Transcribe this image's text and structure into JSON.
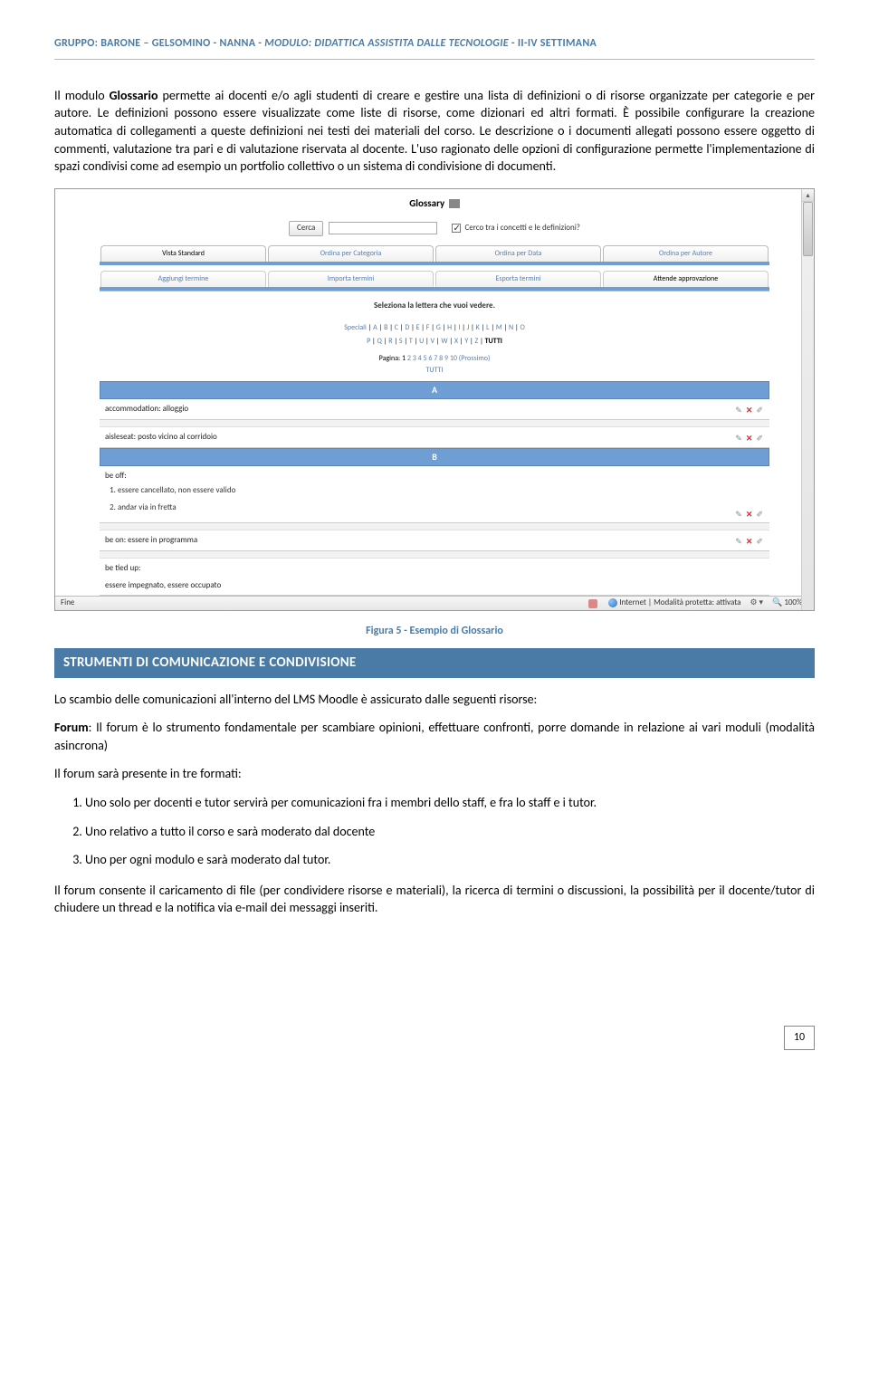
{
  "header": {
    "group": "GRUPPO: BARONE – GELSOMINO - NANNA - ",
    "module": "MODULO: DIDATTICA ASSISTITA DALLE TECNOLOGIE",
    "weeks": " - II-IV SETTIMANA"
  },
  "intro": {
    "p1a": "Il modulo ",
    "p1b": "Glossario",
    "p1c": " permette ai docenti e/o agli studenti di creare e gestire una lista di definizioni o di risorse organizzate per categorie e per autore. Le definizioni possono essere visualizzate come liste di risorse, come dizionari ed altri formati. È possibile configurare la creazione automatica di collegamenti a queste definizioni nei testi dei materiali del corso. Le descrizione o i documenti allegati possono essere oggetto di commenti, valutazione tra pari e di valutazione riservata al docente. L'uso ragionato delle opzioni di configurazione permette l'implementazione di spazi condivisi come ad esempio un portfolio collettivo o un sistema di condivisione di documenti."
  },
  "screenshot": {
    "title": "Glossary",
    "search_button": "Cerca",
    "search_checkbox_label": "Cerco tra i concetti e le definizioni?",
    "tabs": [
      "Vista Standard",
      "Ordina per Categoria",
      "Ordina per Data",
      "Ordina per Autore"
    ],
    "subtabs": [
      "Aggiungi termine",
      "Importa termini",
      "Esporta termini",
      "Attende approvazione"
    ],
    "select_label": "Seleziona la lettera che vuoi vedere.",
    "alpha1_prefix": "Speciali",
    "alpha1": [
      "A",
      "B",
      "C",
      "D",
      "E",
      "F",
      "G",
      "H",
      "I",
      "J",
      "K",
      "L",
      "M",
      "N",
      "O"
    ],
    "alpha2": [
      "P",
      "Q",
      "R",
      "S",
      "T",
      "U",
      "V",
      "W",
      "X",
      "Y",
      "Z"
    ],
    "alpha2_suffix": "TUTTI",
    "pagina_label": "Pagina: 1",
    "pagina_links": [
      "2",
      "3",
      "4",
      "5",
      "6",
      "7",
      "8",
      "9",
      "10"
    ],
    "pagina_next": "(Prossimo)",
    "tutti": "TUTTI",
    "letter_a": "A",
    "entry_a1": "accommodation: alloggio",
    "entry_a2": "aisleseat: posto vicino al corridoio",
    "letter_b": "B",
    "entry_b1_term": "be off:",
    "entry_b1_def1": "essere cancellato, non essere valido",
    "entry_b1_def2": "andar via in fretta",
    "entry_b2": "be on: essere in programma",
    "entry_b3_term": "be tied up:",
    "entry_b3_def": "essere impegnato, essere occupato",
    "status_left": "Fine",
    "status_mode": "Internet | Modalità protetta: attivata",
    "status_zoom": "100%"
  },
  "figure_caption": "Figura 5 - Esempio di Glossario",
  "section_title": "STRUMENTI DI COMUNICAZIONE E CONDIVISIONE",
  "body": {
    "p1": "Lo scambio delle comunicazioni all'interno del LMS Moodle è assicurato dalle seguenti risorse:",
    "p2a": "Forum",
    "p2b": ": Il forum è lo strumento fondamentale per scambiare opinioni, effettuare confronti, porre domande in relazione ai vari moduli (modalità asincrona)",
    "p3": "Il forum sarà presente in tre formati:",
    "li1": "Uno solo per docenti e tutor servirà per comunicazioni fra i membri dello staff, e fra lo staff e i tutor.",
    "li2": "Uno relativo a tutto il corso e sarà moderato dal docente",
    "li3": "Uno per ogni modulo e sarà moderato dal tutor.",
    "p4": "Il forum consente il caricamento di file (per condividere risorse e materiali), la ricerca di termini o discussioni, la possibilità per il docente/tutor di chiudere un thread e la notifica via e-mail dei messaggi inseriti."
  },
  "page_number": "10"
}
